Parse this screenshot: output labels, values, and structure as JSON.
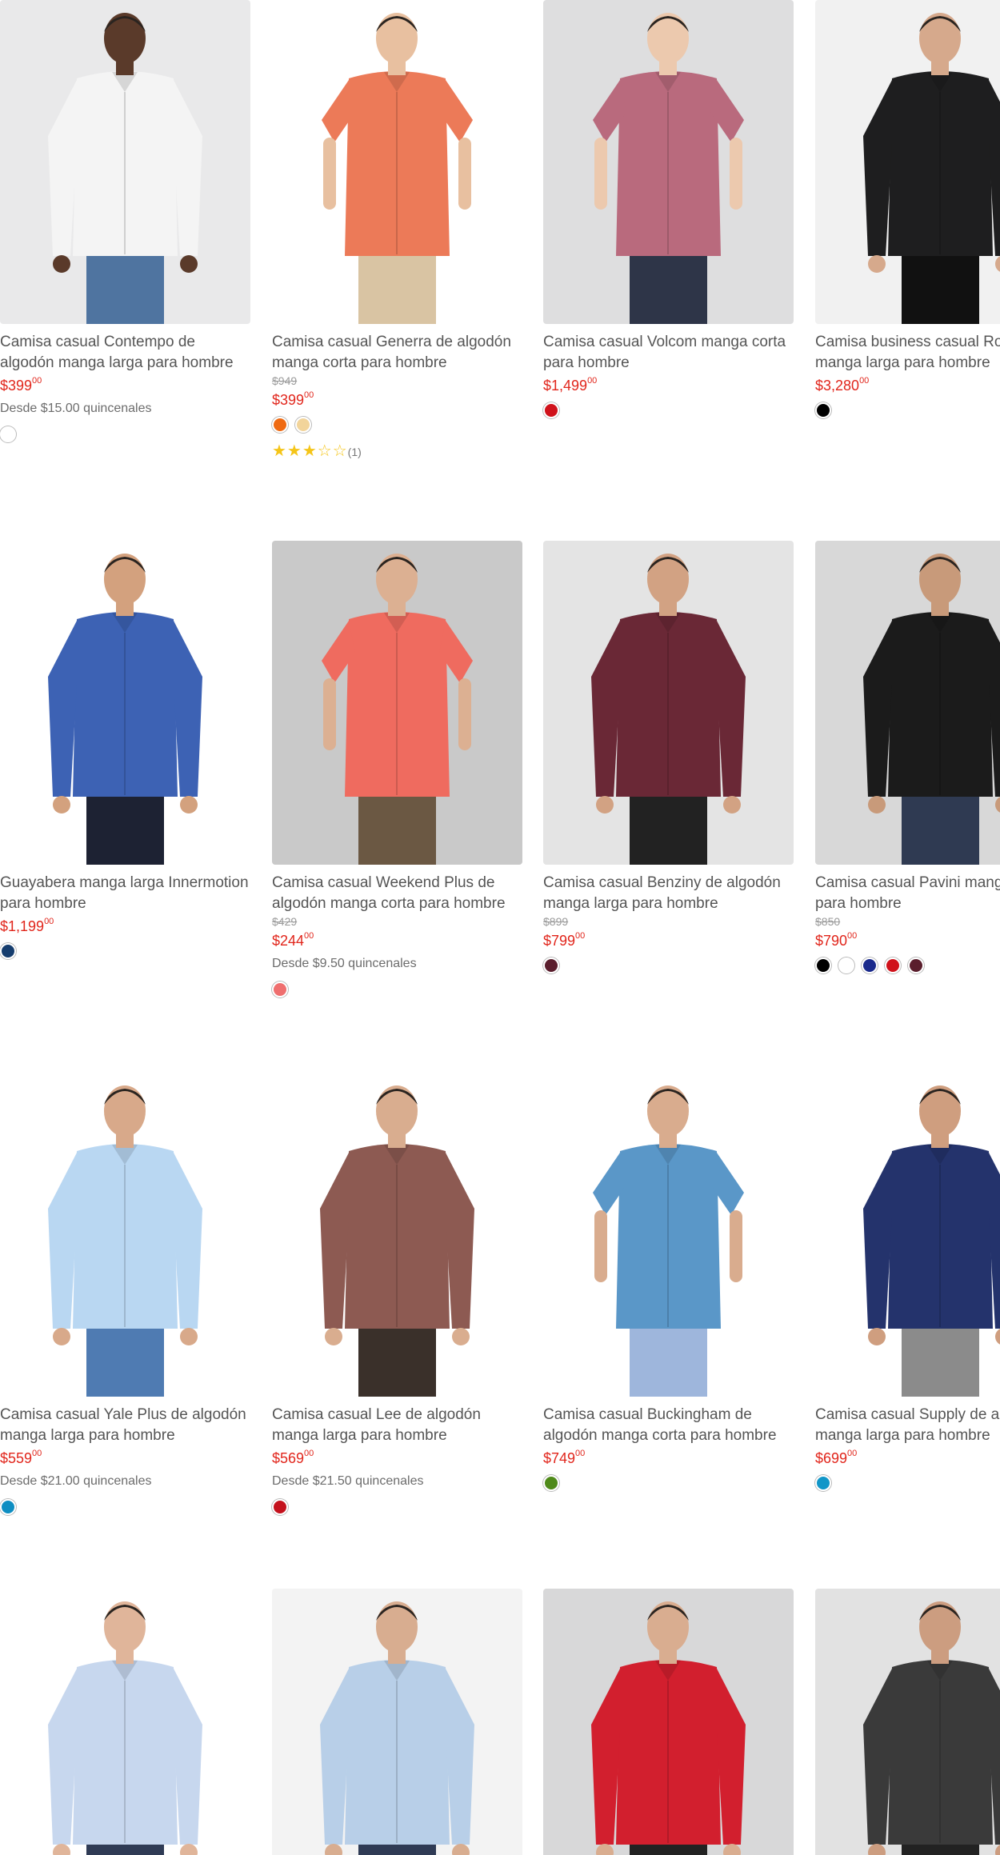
{
  "products": [
    {
      "title": "Camisa casual Contempo de algodón manga larga para hombre",
      "old": "",
      "price": "$399",
      "cents": "00",
      "installments": "Desde $15.00 quincenales",
      "swatches": [
        "#ffffff"
      ],
      "rating": "",
      "img": {
        "bg": "#e9e9ea",
        "shirt": "#f4f4f4",
        "pants": "#4f74a0",
        "skin": "#5a3a2a"
      }
    },
    {
      "title": "Camisa casual Generra de algodón manga corta para hombre",
      "old": "$949",
      "price": "$399",
      "cents": "00",
      "installments": "",
      "swatches": [
        "#ef6a12",
        "#f2d49a"
      ],
      "rating": "★★★☆☆",
      "rating_count": "(1)",
      "img": {
        "bg": "#ffffff",
        "shirt": "#ec7a58",
        "pants": "#d9c4a3",
        "skin": "#e8c0a0"
      }
    },
    {
      "title": "Camisa casual Volcom manga corta para hombre",
      "old": "",
      "price": "$1,499",
      "cents": "00",
      "installments": "",
      "swatches": [
        "#d0121b"
      ],
      "rating": "",
      "img": {
        "bg": "#dededf",
        "shirt": "#b96a7d",
        "pants": "#2e3548",
        "skin": "#ecc9ae"
      }
    },
    {
      "title": "Camisa business casual Robert manga larga para hombre",
      "old": "",
      "price": "$3,280",
      "cents": "00",
      "installments": "",
      "swatches": [
        "#000000"
      ],
      "rating": "",
      "img": {
        "bg": "#f1f1f1",
        "shirt": "#1e1e1f",
        "pants": "#111111",
        "skin": "#d6a98c"
      }
    },
    {
      "title": "Guayabera manga larga Innermotion para hombre",
      "old": "",
      "price": "$1,199",
      "cents": "00",
      "installments": "",
      "swatches": [
        "#163d6e"
      ],
      "rating": "",
      "img": {
        "bg": "#ffffff",
        "shirt": "#3d62b4",
        "pants": "#1d2233",
        "skin": "#d3a17e"
      }
    },
    {
      "title": "Camisa casual Weekend Plus de algodón manga corta para hombre",
      "old": "$429",
      "price": "$244",
      "cents": "00",
      "installments": "Desde $9.50 quincenales",
      "swatches": [
        "#ef6f6f"
      ],
      "rating": "",
      "img": {
        "bg": "#c9c9c9",
        "shirt": "#ef6b5f",
        "pants": "#6b5843",
        "skin": "#dcb092"
      }
    },
    {
      "title": "Camisa casual Benziny de algodón manga larga para hombre",
      "old": "$899",
      "price": "$799",
      "cents": "00",
      "installments": "",
      "swatches": [
        "#5a1e2d"
      ],
      "rating": "",
      "img": {
        "bg": "#e4e4e4",
        "shirt": "#6a2836",
        "pants": "#222222",
        "skin": "#d2a283"
      }
    },
    {
      "title": "Camisa casual Pavini manga larga para hombre",
      "old": "$850",
      "price": "$790",
      "cents": "00",
      "installments": "",
      "swatches": [
        "#000000",
        "#ffffff",
        "#1a2a8c",
        "#d0121b",
        "#5a1e2d"
      ],
      "rating": "",
      "img": {
        "bg": "#d8d8d8",
        "shirt": "#1b1b1b",
        "pants": "#2f3a52",
        "skin": "#c89a7a"
      }
    },
    {
      "title": "Camisa casual Yale Plus de algodón manga larga para hombre",
      "old": "",
      "price": "$559",
      "cents": "00",
      "installments": "Desde $21.00 quincenales",
      "swatches": [
        "#0f8ec2"
      ],
      "rating": "",
      "img": {
        "bg": "#ffffff",
        "shirt": "#b9d7f2",
        "pants": "#4f7bb2",
        "skin": "#d8a98a"
      }
    },
    {
      "title": "Camisa casual Lee de algodón manga larga para hombre",
      "old": "",
      "price": "$569",
      "cents": "00",
      "installments": "Desde $21.50 quincenales",
      "swatches": [
        "#c4121d"
      ],
      "rating": "",
      "img": {
        "bg": "#ffffff",
        "shirt": "#8d5a52",
        "pants": "#3a302a",
        "skin": "#d9ad8f"
      }
    },
    {
      "title": "Camisa casual Buckingham de algodón manga corta para hombre",
      "old": "",
      "price": "$749",
      "cents": "00",
      "installments": "",
      "swatches": [
        "#4f8a1a"
      ],
      "rating": "",
      "img": {
        "bg": "#ffffff",
        "shirt": "#5a97c8",
        "pants": "#9eb6dc",
        "skin": "#d9ac8e"
      }
    },
    {
      "title": "Camisa casual Supply de algodón manga larga para hombre",
      "old": "",
      "price": "$699",
      "cents": "00",
      "installments": "",
      "swatches": [
        "#1196c8"
      ],
      "rating": "",
      "img": {
        "bg": "#ffffff",
        "shirt": "#24336c",
        "pants": "#8b8b8b",
        "skin": "#cf9e7f"
      }
    },
    {
      "title": "",
      "old": "",
      "price": "",
      "cents": "",
      "installments": "",
      "swatches": [],
      "rating": "",
      "img": {
        "bg": "#ffffff",
        "shirt": "#c7d7ee",
        "pants": "#2f3b55",
        "skin": "#e0b59a"
      }
    },
    {
      "title": "",
      "old": "",
      "price": "",
      "cents": "",
      "installments": "",
      "swatches": [],
      "rating": "",
      "img": {
        "bg": "#f3f3f3",
        "shirt": "#b8cfe8",
        "pants": "#2f3b55",
        "skin": "#d8ad90"
      }
    },
    {
      "title": "",
      "old": "",
      "price": "",
      "cents": "",
      "installments": "",
      "swatches": [],
      "rating": "",
      "img": {
        "bg": "#d8d8d9",
        "shirt": "#d21f2e",
        "pants": "#222222",
        "skin": "#d9ad90"
      }
    },
    {
      "title": "",
      "old": "",
      "price": "",
      "cents": "",
      "installments": "",
      "swatches": [],
      "rating": "",
      "img": {
        "bg": "#e2e2e2",
        "shirt": "#3a3a3a",
        "pants": "#222222",
        "skin": "#cc9d80"
      }
    }
  ]
}
